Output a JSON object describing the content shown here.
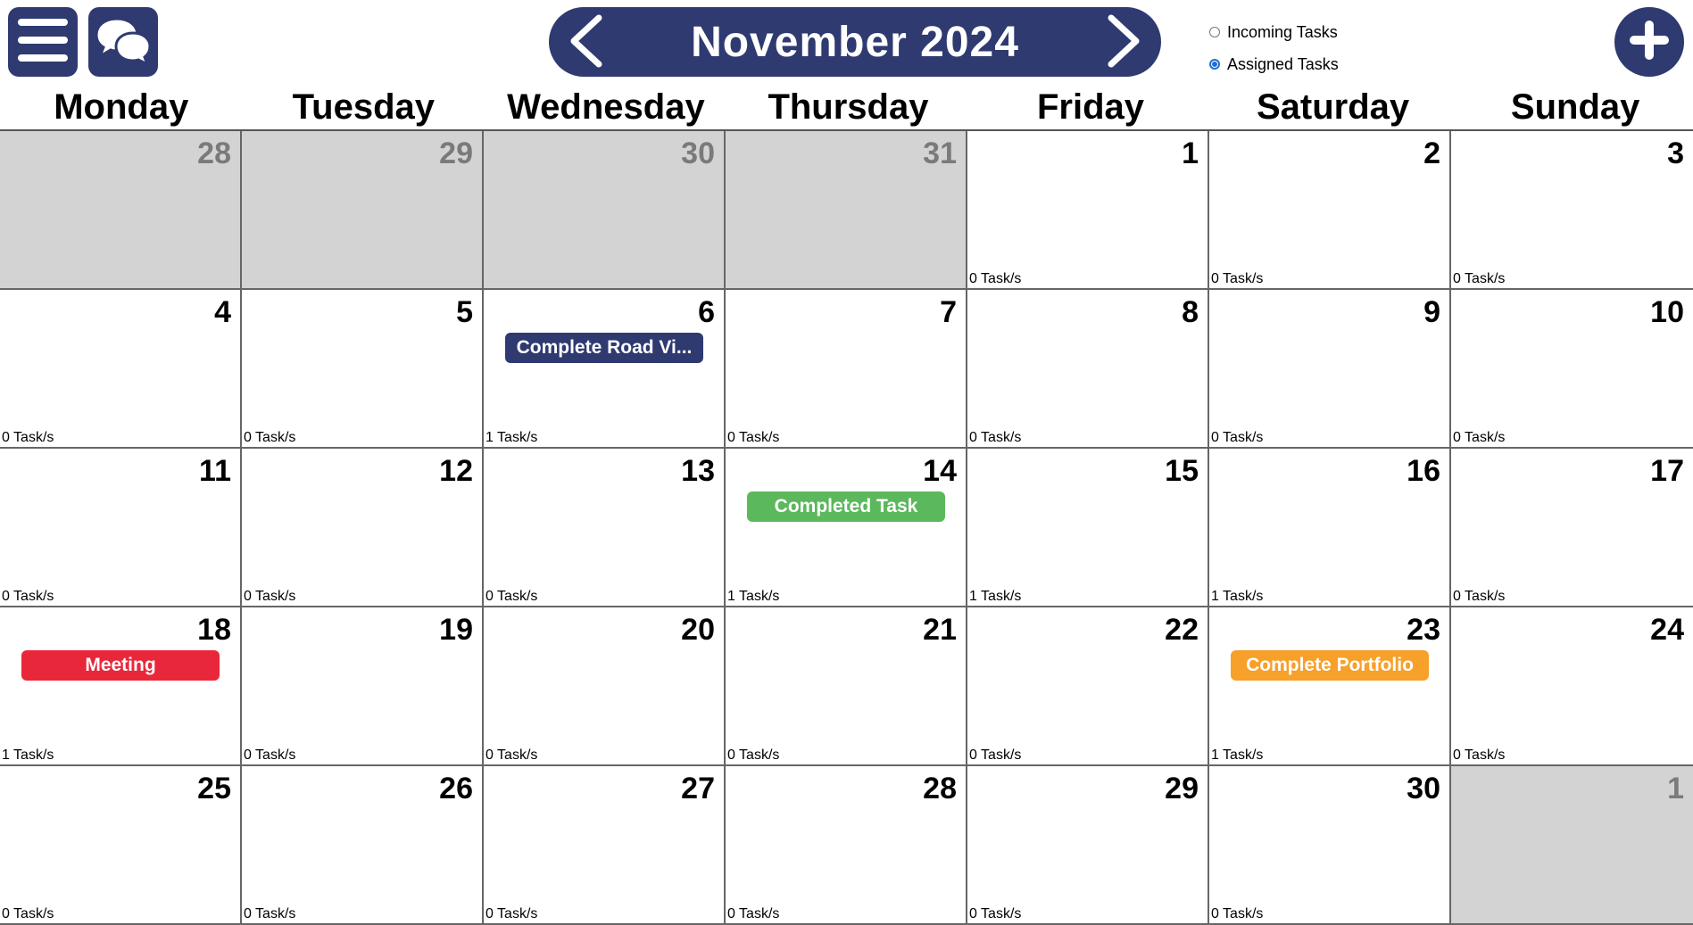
{
  "header": {
    "month_title": "November 2024",
    "radio_incoming": "Incoming Tasks",
    "radio_assigned": "Assigned Tasks",
    "selected_filter": "Assigned Tasks"
  },
  "weekdays": [
    "Monday",
    "Tuesday",
    "Wednesday",
    "Thursday",
    "Friday",
    "Saturday",
    "Sunday"
  ],
  "colors": {
    "brand": "#2e3a70",
    "other_month": "#d3d3d3",
    "task_navy": "#2e3a70",
    "task_green": "#5cb85c",
    "task_red": "#e8283a",
    "task_orange": "#f7a02a"
  },
  "weeks": [
    [
      {
        "day": "28",
        "other": true
      },
      {
        "day": "29",
        "other": true
      },
      {
        "day": "30",
        "other": true
      },
      {
        "day": "31",
        "other": true
      },
      {
        "day": "1",
        "count": "0 Task/s"
      },
      {
        "day": "2",
        "count": "0 Task/s"
      },
      {
        "day": "3",
        "count": "0 Task/s"
      }
    ],
    [
      {
        "day": "4",
        "count": "0 Task/s"
      },
      {
        "day": "5",
        "count": "0 Task/s"
      },
      {
        "day": "6",
        "count": "1 Task/s",
        "task": {
          "label": "Complete Road Vi...",
          "color": "#2e3a70"
        }
      },
      {
        "day": "7",
        "count": "0 Task/s"
      },
      {
        "day": "8",
        "count": "0 Task/s"
      },
      {
        "day": "9",
        "count": "0 Task/s"
      },
      {
        "day": "10",
        "count": "0 Task/s"
      }
    ],
    [
      {
        "day": "11",
        "count": "0 Task/s"
      },
      {
        "day": "12",
        "count": "0 Task/s"
      },
      {
        "day": "13",
        "count": "0 Task/s"
      },
      {
        "day": "14",
        "count": "1 Task/s",
        "task": {
          "label": "Completed Task",
          "color": "#5cb85c"
        }
      },
      {
        "day": "15",
        "count": "1 Task/s"
      },
      {
        "day": "16",
        "count": "1 Task/s"
      },
      {
        "day": "17",
        "count": "0 Task/s"
      }
    ],
    [
      {
        "day": "18",
        "count": "1 Task/s",
        "task": {
          "label": "Meeting",
          "color": "#e8283a"
        }
      },
      {
        "day": "19",
        "count": "0 Task/s"
      },
      {
        "day": "20",
        "count": "0 Task/s"
      },
      {
        "day": "21",
        "count": "0 Task/s"
      },
      {
        "day": "22",
        "count": "0 Task/s"
      },
      {
        "day": "23",
        "count": "1 Task/s",
        "task": {
          "label": "Complete Portfolio",
          "color": "#f7a02a"
        }
      },
      {
        "day": "24",
        "count": "0 Task/s"
      }
    ],
    [
      {
        "day": "25",
        "count": "0 Task/s"
      },
      {
        "day": "26",
        "count": "0 Task/s"
      },
      {
        "day": "27",
        "count": "0 Task/s"
      },
      {
        "day": "28",
        "count": "0 Task/s"
      },
      {
        "day": "29",
        "count": "0 Task/s"
      },
      {
        "day": "30",
        "count": "0 Task/s"
      },
      {
        "day": "1",
        "other": true
      }
    ]
  ]
}
